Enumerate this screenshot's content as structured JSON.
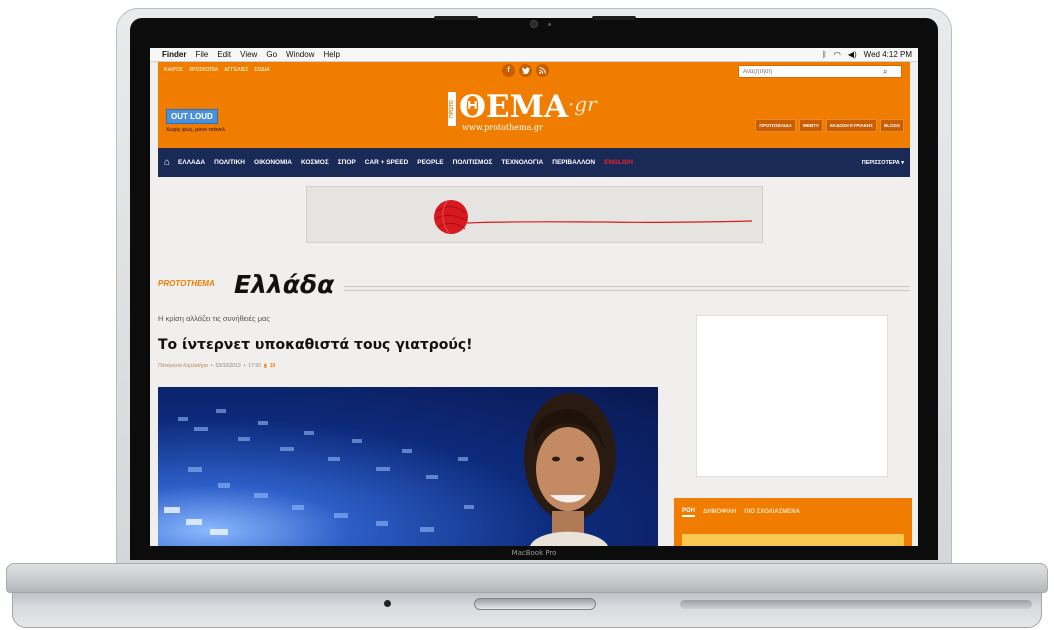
{
  "device": {
    "model_label": "MacBook Pro"
  },
  "menubar": {
    "apple": "",
    "items": [
      "Finder",
      "File",
      "Edit",
      "View",
      "Go",
      "Window",
      "Help"
    ],
    "clock": "Wed 4:12 PM"
  },
  "header": {
    "top_links": [
      "ΚΑΙΡΟΣ",
      "ΧΡΟΣΚΟΠΙΑ",
      "ΑΓΓΕΛΙΕΣ",
      "ΣΟΔΙΑ"
    ],
    "socials": [
      "f",
      "t",
      "rss"
    ],
    "search_placeholder": "Αναζήτηση",
    "outloud_badge": "OUT LOUD",
    "outloud_sub": "Χωρίς φως, μόνο τσάνελ",
    "logo_proto": "ΠΡΩΤΟ",
    "logo_main": "ΘΕΜΑ",
    "logo_gr": "·gr",
    "logo_url": "www.protothema.gr",
    "buttons": [
      "ΠΡΟΤΟΣΕΛΙΔΑ",
      "WEBTV",
      "ΕΚΔΟΣΗ ΚΥΡΙΑΚΗΣ",
      "BLOGS"
    ]
  },
  "nav": {
    "items": [
      "ΕΛΛΑΔΑ",
      "ΠΟΛΙΤΙΚΗ",
      "ΟΙΚΟΝΟΜΙΑ",
      "ΚΟΣΜΟΣ",
      "ΣΠΟΡ",
      "CAR + SPEED",
      "PEOPLE",
      "ΠΟΛΙΤΙΣΜΟΣ",
      "ΤΕΧΝΟΛΟΓΙΑ",
      "ΠΕΡΙΒΑΛΛΟΝ"
    ],
    "english": "ENGLISH",
    "more": "ΠΕΡΙΣΣΟΤΕΡΑ ▾"
  },
  "section": {
    "kicker": "PROTOTHEMA",
    "title": "Ελλάδα"
  },
  "article": {
    "kicker": "Η κρίση αλλάζει τις συνήθειές μας",
    "headline": "Το ίντερνετ υποκαθιστά τους γιατρούς!",
    "author": "Παναγιώτα Καρλατήρα",
    "date": "03/10/2013",
    "time": "17:50",
    "comments": "10"
  },
  "sidebar": {
    "tabs": [
      "ΡΟΗ",
      "ΔΗΜΟΦΙΛΗ",
      "ΠΙΟ ΣΧΟΛΙΑΣΜΕΝΑ"
    ]
  }
}
